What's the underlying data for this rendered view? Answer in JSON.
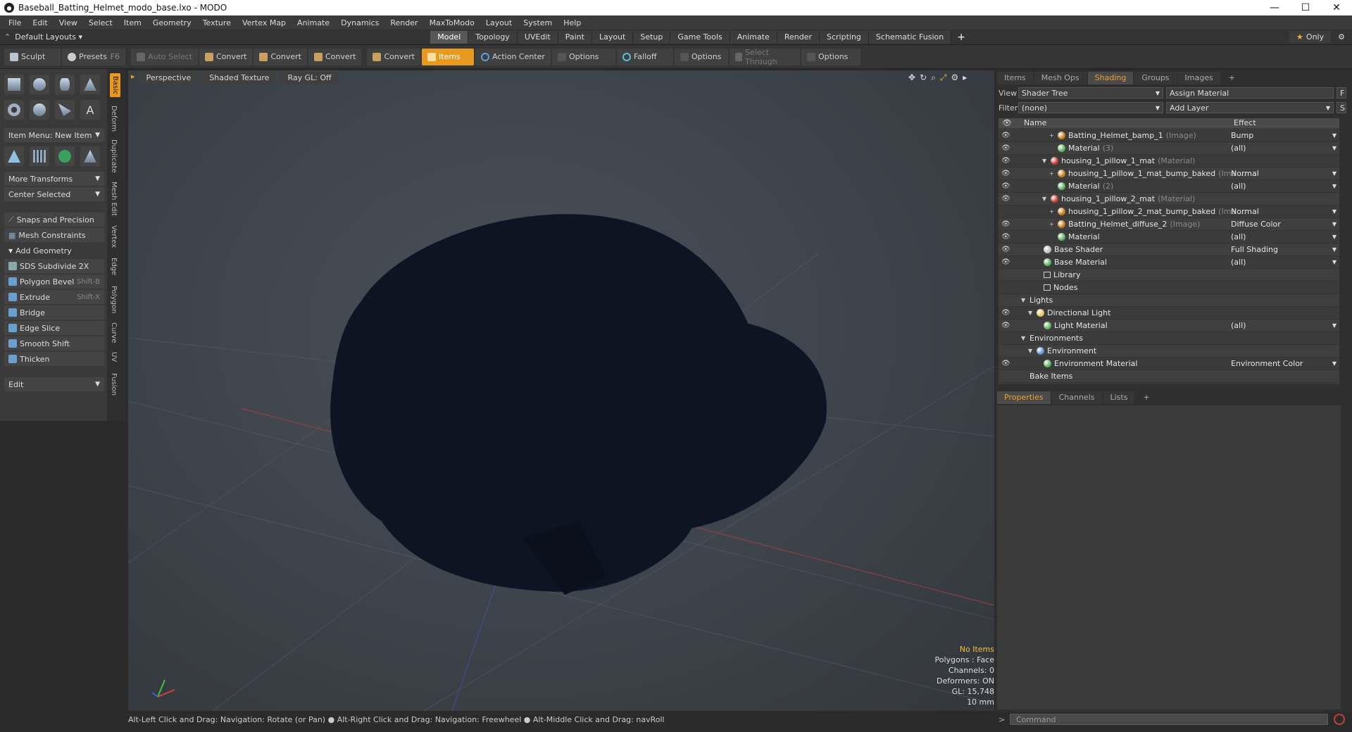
{
  "window": {
    "title": "Baseball_Batting_Helmet_modo_base.lxo - MODO",
    "controls": [
      "—",
      "☐",
      "✕"
    ]
  },
  "menu": [
    "File",
    "Edit",
    "View",
    "Select",
    "Item",
    "Geometry",
    "Texture",
    "Vertex Map",
    "Animate",
    "Dynamics",
    "Render",
    "MaxToModo",
    "Layout",
    "System",
    "Help"
  ],
  "layoutbar": {
    "layouts_label": "Default Layouts ▾",
    "tabs": [
      "Model",
      "Topology",
      "UVEdit",
      "Paint",
      "Layout",
      "Setup",
      "Game Tools",
      "Animate",
      "Render",
      "Scripting",
      "Schematic Fusion"
    ],
    "active_tab": "Model",
    "add": "+",
    "only": "Only"
  },
  "toolbar": {
    "sculpt": "Sculpt",
    "presets": "Presets",
    "presets_key": "F6",
    "auto_select": "Auto Select",
    "convert": "Convert",
    "items": "Items",
    "action_center": "Action Center",
    "options": "Options",
    "falloff": "Falloff",
    "select_through": "Select Through"
  },
  "left": {
    "item_menu": "Item Menu: New Item",
    "more_transforms": "More Transforms",
    "center_selected": "Center Selected",
    "snaps": "Snaps and Precision",
    "mesh_constraints": "Mesh Constraints",
    "add_geometry": "Add Geometry",
    "tools": [
      {
        "label": "SDS Subdivide 2X",
        "key": ""
      },
      {
        "label": "Polygon Bevel",
        "key": "Shift-B"
      },
      {
        "label": "Extrude",
        "key": "Shift-X"
      },
      {
        "label": "Bridge",
        "key": ""
      },
      {
        "label": "Edge Slice",
        "key": ""
      },
      {
        "label": "Smooth Shift",
        "key": ""
      },
      {
        "label": "Thicken",
        "key": ""
      }
    ],
    "edit": "Edit",
    "vtabs": [
      "Basic",
      "Deform",
      "Duplicate",
      "Mesh Edit",
      "Vertex",
      "Edge",
      "Polygon",
      "Curve",
      "UV",
      "Fusion"
    ]
  },
  "viewport": {
    "perspective": "Perspective",
    "shading": "Shaded Texture",
    "raygl": "Ray GL: Off",
    "hud": {
      "selection": "No Items",
      "polygons": "Polygons : Face",
      "channels": "Channels: 0",
      "deformers": "Deformers: ON",
      "gl": "GL: 15,748",
      "scale": "10 mm"
    }
  },
  "status": "Alt-Left Click and Drag: Navigation: Rotate (or Pan) ● Alt-Right Click and Drag: Navigation: Freewheel ● Alt-Middle Click and Drag: navRoll",
  "right": {
    "tabs": [
      "Items",
      "Mesh Ops",
      "Shading",
      "Groups",
      "Images",
      "+"
    ],
    "active_tab": "Shading",
    "view_label": "View",
    "view_value": "Shader Tree",
    "assign_material": "Assign Material",
    "f_btn": "F",
    "filter_label": "Filter",
    "filter_value": "(none)",
    "add_layer": "Add Layer",
    "s_btn": "S",
    "col_name": "Name",
    "col_effect": "Effect",
    "tree": [
      {
        "indent": 5,
        "twirl": "+",
        "color": "#c47a1a",
        "name": "Batting_Helmet_bamp_1",
        "sub": "(Image)",
        "effect": "Bump",
        "eye": true
      },
      {
        "indent": 5,
        "twirl": "",
        "color": "#5fae5f",
        "name": "Material",
        "sub": "(3)",
        "effect": "(all)",
        "eye": true
      },
      {
        "indent": 4,
        "twirl": "▼",
        "color": "#c0392b",
        "name": "housing_1_pillow_1_mat",
        "sub": "(Material)",
        "effect": "",
        "eye": true
      },
      {
        "indent": 5,
        "twirl": "+",
        "color": "#c47a1a",
        "name": "housing_1_pillow_1_mat_bump_baked",
        "sub": "(Ima ...",
        "effect": "Normal",
        "eye": true
      },
      {
        "indent": 5,
        "twirl": "",
        "color": "#5fae5f",
        "name": "Material",
        "sub": "(2)",
        "effect": "(all)",
        "eye": true
      },
      {
        "indent": 4,
        "twirl": "▼",
        "color": "#c0392b",
        "name": "housing_1_pillow_2_mat",
        "sub": "(Material)",
        "effect": "",
        "eye": true
      },
      {
        "indent": 5,
        "twirl": "+",
        "color": "#c47a1a",
        "name": "housing_1_pillow_2_mat_bump_baked",
        "sub": "(Ima ...",
        "effect": "Normal",
        "eye": false
      },
      {
        "indent": 5,
        "twirl": "+",
        "color": "#c47a1a",
        "name": "Batting_Helmet_diffuse_2",
        "sub": "(Image)",
        "effect": "Diffuse Color",
        "eye": true
      },
      {
        "indent": 5,
        "twirl": "",
        "color": "#5fae5f",
        "name": "Material",
        "sub": "",
        "effect": "(all)",
        "eye": true
      },
      {
        "indent": 3,
        "twirl": "",
        "color": "#bbbbbb",
        "name": "Base Shader",
        "sub": "",
        "effect": "Full Shading",
        "eye": true
      },
      {
        "indent": 3,
        "twirl": "",
        "color": "#5fae5f",
        "name": "Base Material",
        "sub": "",
        "effect": "(all)",
        "eye": true
      },
      {
        "indent": 3,
        "twirl": "",
        "color": "folder",
        "name": "Library",
        "sub": "",
        "effect": "",
        "eye": false
      },
      {
        "indent": 3,
        "twirl": "",
        "color": "folder",
        "name": "Nodes",
        "sub": "",
        "effect": "",
        "eye": false
      },
      {
        "indent": 1,
        "twirl": "▼",
        "color": "",
        "name": "Lights",
        "sub": "",
        "effect": "",
        "eye": false
      },
      {
        "indent": 2,
        "twirl": "▼",
        "color": "#e0c060",
        "name": "Directional Light",
        "sub": "",
        "effect": "",
        "eye": true
      },
      {
        "indent": 3,
        "twirl": "",
        "color": "#5fae5f",
        "name": "Light Material",
        "sub": "",
        "effect": "(all)",
        "eye": true
      },
      {
        "indent": 1,
        "twirl": "▼",
        "color": "",
        "name": "Environments",
        "sub": "",
        "effect": "",
        "eye": false
      },
      {
        "indent": 2,
        "twirl": "▼",
        "color": "#5a8fd0",
        "name": "Environment",
        "sub": "",
        "effect": "",
        "eye": false
      },
      {
        "indent": 3,
        "twirl": "",
        "color": "#5fae5f",
        "name": "Environment Material",
        "sub": "",
        "effect": "Environment Color",
        "eye": true
      },
      {
        "indent": 1,
        "twirl": "",
        "color": "",
        "name": "Bake Items",
        "sub": "",
        "effect": "",
        "eye": false
      }
    ],
    "bottom_tabs": [
      "Properties",
      "Channels",
      "Lists",
      "+"
    ],
    "bottom_active": "Properties",
    "command_placeholder": "Command"
  }
}
